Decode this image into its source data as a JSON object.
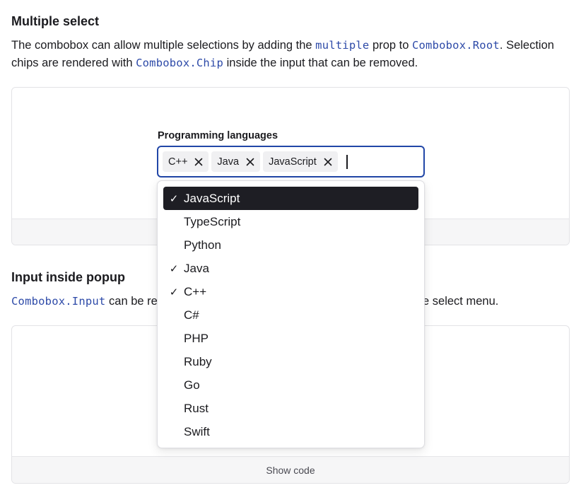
{
  "section1": {
    "title": "Multiple select",
    "desc": {
      "part1": "The combobox can allow multiple selections by adding the ",
      "code1": "multiple",
      "part2": " prop to ",
      "code2": "Combobox.Root",
      "part3": ". Selection chips are rendered with ",
      "code3": "Combobox.Chip",
      "part4": " inside the input that can be removed."
    }
  },
  "demo1": {
    "label": "Programming languages",
    "chips": [
      "C++",
      "Java",
      "JavaScript"
    ],
    "options": [
      {
        "label": "JavaScript",
        "selected": true,
        "highlighted": true
      },
      {
        "label": "TypeScript",
        "selected": false
      },
      {
        "label": "Python",
        "selected": false
      },
      {
        "label": "Java",
        "selected": true
      },
      {
        "label": "C++",
        "selected": true
      },
      {
        "label": "C#",
        "selected": false
      },
      {
        "label": "PHP",
        "selected": false
      },
      {
        "label": "Ruby",
        "selected": false
      },
      {
        "label": "Go",
        "selected": false
      },
      {
        "label": "Rust",
        "selected": false
      },
      {
        "label": "Swift",
        "selected": false
      }
    ],
    "check_glyph": "✓"
  },
  "section2": {
    "title": "Input inside popup",
    "desc": {
      "code1": "Combobox.Input",
      "part1": " can be re",
      "part2": "able select menu."
    }
  },
  "demo2": {
    "show_code_label": "Show code"
  },
  "icons": {
    "chip_remove": "x-icon",
    "check": "check-icon"
  },
  "colors": {
    "accent": "#2146a7",
    "code": "#2d4aa8",
    "highlight": "#1e1e24"
  }
}
